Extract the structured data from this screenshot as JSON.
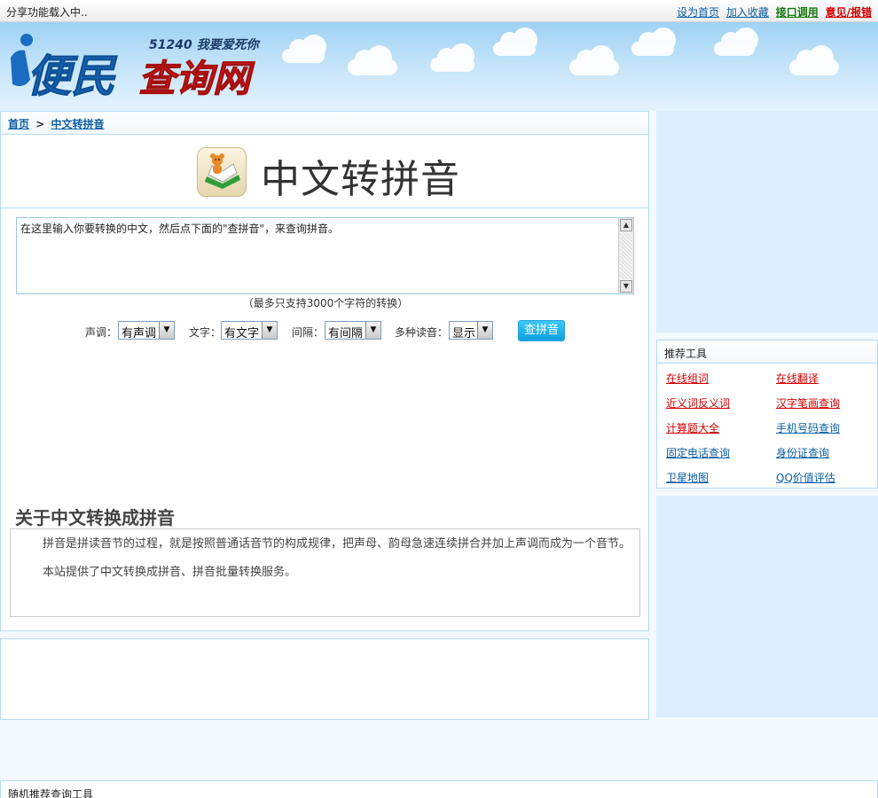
{
  "topbar": {
    "share_text": "分享功能载入中..",
    "links": [
      "设为首页",
      "加入收藏",
      "接口调用",
      "意见/报错"
    ]
  },
  "logo": {
    "tagline": "51240 我要爱死你",
    "part1": "便民",
    "part2": "查询网"
  },
  "breadcrumb": {
    "home": "首页",
    "sep": ">",
    "current": "中文转拼音"
  },
  "page": {
    "title": "中文转拼音"
  },
  "input": {
    "value": "在这里输入你要转换的中文，然后点下面的\"查拼音\"，来查询拼音。",
    "hint": "（最多只支持3000个字符的转换）"
  },
  "options": [
    {
      "label": "声调：",
      "value": "有声调"
    },
    {
      "label": "文字：",
      "value": "有文字"
    },
    {
      "label": "间隔：",
      "value": "有间隔"
    },
    {
      "label": "多种读音：",
      "value": "显示"
    }
  ],
  "submit_label": "查拼音",
  "about": {
    "heading": "关于中文转换成拼音",
    "p1": "拼音是拼读音节的过程，就是按照普通话音节的构成规律，把声母、韵母急速连续拼合并加上声调而成为一个音节。",
    "p2": "本站提供了中文转换成拼音、拼音批量转换服务。"
  },
  "tools": {
    "heading": "推荐工具",
    "items": [
      "在线组词",
      "在线翻译",
      "近义词反义词",
      "汉字笔画查询",
      "计算题大全",
      "手机号码查询",
      "固定电话查询",
      "身份证查询",
      "卫星地图",
      "QQ价值评估"
    ]
  },
  "bottom": {
    "heading": "随机推荐查询工具"
  },
  "colors": {
    "accent_blue": "#0b5fa3",
    "link_red": "#d40000",
    "button": "#1aa8e6",
    "panel_border": "#b3dcef"
  }
}
